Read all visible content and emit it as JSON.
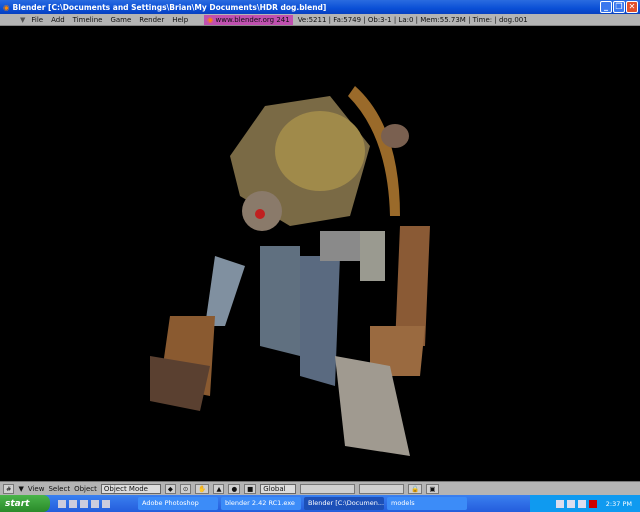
{
  "window": {
    "title": "Blender [C:\\Documents and Settings\\Brian\\My Documents\\HDR dog.blend]"
  },
  "menu": {
    "items": [
      "File",
      "Add",
      "Timeline",
      "Game",
      "Render",
      "Help"
    ],
    "website": "www.blender.org 241",
    "stats": "Ve:5211 | Fa:5749 | Ob:3-1 | La:0  | Mem:55.73M  | Time: | dog.001"
  },
  "toolbar": {
    "view": "View",
    "select": "Select",
    "object": "Object",
    "mode": "Object Mode",
    "orientation": "Global"
  },
  "taskbar": {
    "start": "start",
    "tasks": [
      {
        "label": "Adobe Photoshop",
        "active": false
      },
      {
        "label": "blender 2.42 RC1.exe",
        "active": false
      },
      {
        "label": "Blender [C:\\Documen...",
        "active": true
      },
      {
        "label": "models",
        "active": false
      }
    ],
    "clock": "2:37 PM"
  }
}
